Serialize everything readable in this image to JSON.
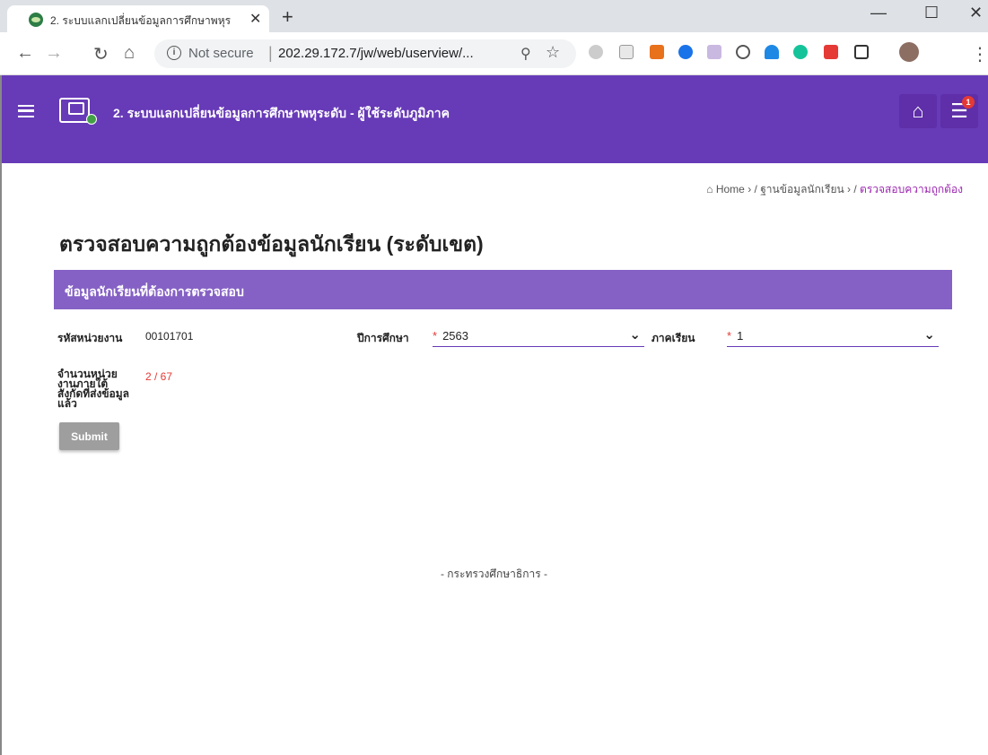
{
  "browser": {
    "tab_title": "2. ระบบแลกเปลี่ยนข้อมูลการศึกษาพหุร",
    "tab_close": "✕",
    "new_tab": "+",
    "secure_label": "Not secure",
    "url": "202.29.172.7/jw/web/userview/...",
    "window_controls": [
      "—",
      "☐",
      "✕"
    ]
  },
  "header": {
    "title": "2. ระบบแลกเปลี่ยนข้อมูลการศึกษาพหุระดับ - ผู้ใช้ระดับภูมิภาค",
    "notification_count": "1",
    "accent_color": "#673ab7"
  },
  "breadcrumb": {
    "home": "Home",
    "level2": "ฐานข้อมูลนักเรียน",
    "current": "ตรวจสอบความถูกต้อง"
  },
  "page": {
    "title": "ตรวจสอบความถูกต้องข้อมูลนักเรียน (ระดับเขต)"
  },
  "panel": {
    "title": "ข้อมูลนักเรียนที่ต้องการตรวจสอบ",
    "unit_code_label": "รหัสหน่วยงาน",
    "unit_code_value": "00101701",
    "year_label": "ปีการศึกษา",
    "year_value": "2563",
    "semester_label": "ภาคเรียน",
    "semester_value": "1",
    "count_label": "จำนวนหน่วยงานภายใต้สังกัดที่ส่งข้อมูลแล้ว",
    "count_value": "2 / 67",
    "submit_label": "Submit"
  },
  "footer": {
    "text": "- กระทรวงศึกษาธิการ -"
  }
}
